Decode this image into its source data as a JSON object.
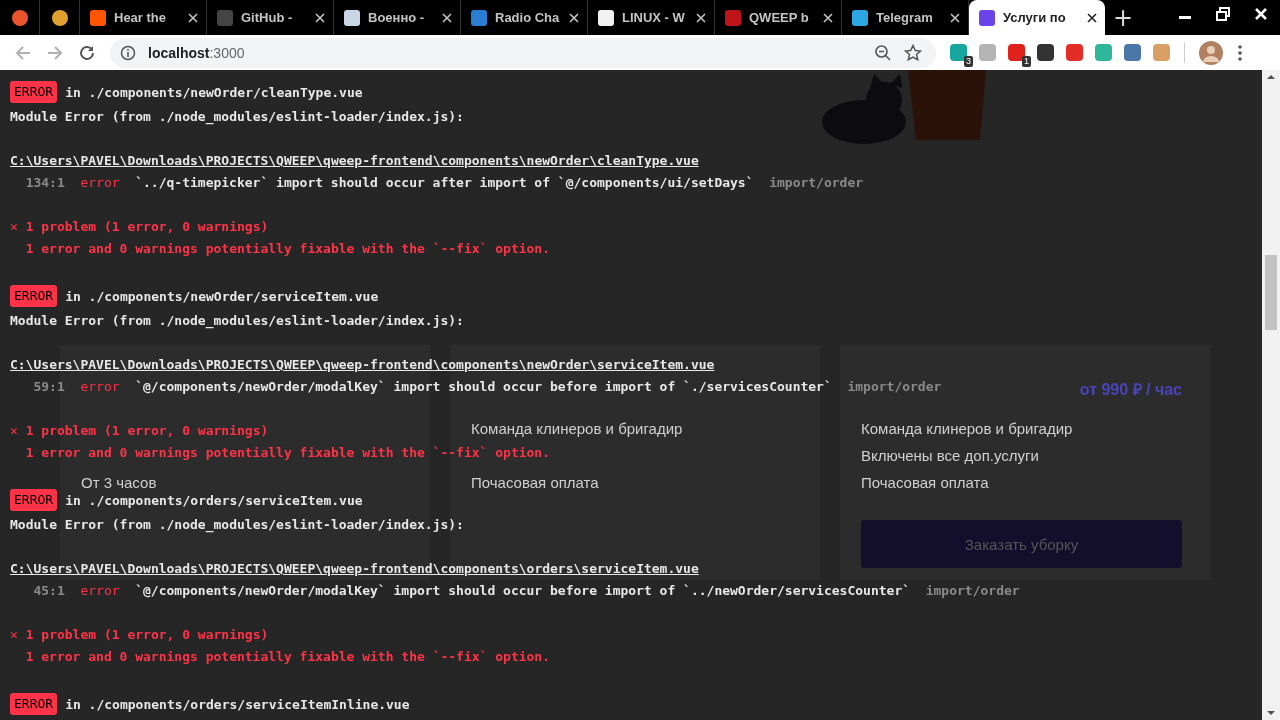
{
  "browser": {
    "tabs": [
      {
        "kind": "pinned",
        "color": "#e8542e",
        "selected": false
      },
      {
        "kind": "pinned",
        "color": "#e0a030",
        "selected": false
      },
      {
        "kind": "tab",
        "title": "Hear the",
        "color": "#ff5500",
        "selected": false
      },
      {
        "kind": "tab",
        "title": "GitHub -",
        "color": "#444444",
        "selected": false
      },
      {
        "kind": "tab",
        "title": "Военно -",
        "color": "#c9d6e6",
        "selected": false
      },
      {
        "kind": "tab",
        "title": "Radio Cha",
        "color": "#2b7cd3",
        "selected": false
      },
      {
        "kind": "tab",
        "title": "LINUX - W",
        "color": "#f2f2f2",
        "selected": false
      },
      {
        "kind": "tab",
        "title": "QWEEP b",
        "color": "#c0141b",
        "selected": false
      },
      {
        "kind": "tab",
        "title": "Telegram",
        "color": "#2ca5e0",
        "selected": false
      },
      {
        "kind": "tab",
        "title": "Услуги по",
        "color": "#6b45e8",
        "selected": true
      }
    ],
    "new_tab": "+",
    "address": {
      "host": "localhost",
      "port": ":3000"
    },
    "extensions": [
      {
        "color": "#17a5a0",
        "badge": "3"
      },
      {
        "color": "#b5b5b5"
      },
      {
        "color": "#e0201b",
        "badge": "1"
      },
      {
        "color": "#333333"
      },
      {
        "color": "#e52d27"
      },
      {
        "color": "#2fb59a"
      },
      {
        "color": "#4a76a8"
      },
      {
        "color": "#d9a066"
      }
    ]
  },
  "page": {
    "cards": [
      {
        "features": [
          "От 3 часов"
        ]
      },
      {
        "features": [
          "Команда клинеров и бригадир",
          "Почасовая оплата"
        ]
      },
      {
        "price": "от 990 ₽ / час",
        "features": [
          "Команда клинеров и бригадир",
          "Включены все доп.услуги",
          "Почасовая оплата"
        ],
        "button": "Заказать уборку"
      }
    ]
  },
  "errors": [
    {
      "badge": "ERROR",
      "file": "in ./components/newOrder/cleanType.vue",
      "source": "Module Error (from ./node_modules/eslint-loader/index.js):",
      "path": "C:\\Users\\PAVEL\\Downloads\\PROJECTS\\QWEEP\\qweep-frontend\\components\\newOrder\\cleanType.vue",
      "location": "134:1",
      "severity": "error",
      "message": "`../q-timepicker` import should occur after import of `@/components/ui/setDays`",
      "rule": "import/order",
      "summary": "✕ 1 problem (1 error, 0 warnings)",
      "hint": "1 error and 0 warnings potentially fixable with the `--fix` option."
    },
    {
      "badge": "ERROR",
      "file": "in ./components/newOrder/serviceItem.vue",
      "source": "Module Error (from ./node_modules/eslint-loader/index.js):",
      "path": "C:\\Users\\PAVEL\\Downloads\\PROJECTS\\QWEEP\\qweep-frontend\\components\\newOrder\\serviceItem.vue",
      "location": "59:1",
      "severity": "error",
      "message": "`@/components/newOrder/modalKey` import should occur before import of `./servicesCounter`",
      "rule": "import/order",
      "summary": "✕ 1 problem (1 error, 0 warnings)",
      "hint": "1 error and 0 warnings potentially fixable with the `--fix` option."
    },
    {
      "badge": "ERROR",
      "file": "in ./components/orders/serviceItem.vue",
      "source": "Module Error (from ./node_modules/eslint-loader/index.js):",
      "path": "C:\\Users\\PAVEL\\Downloads\\PROJECTS\\QWEEP\\qweep-frontend\\components\\orders\\serviceItem.vue",
      "location": "45:1",
      "severity": "error",
      "message": "`@/components/newOrder/modalKey` import should occur before import of `../newOrder/servicesCounter`",
      "rule": "import/order",
      "summary": "✕ 1 problem (1 error, 0 warnings)",
      "hint": "1 error and 0 warnings potentially fixable with the `--fix` option."
    },
    {
      "badge": "ERROR",
      "file": "in ./components/orders/serviceItemInline.vue"
    }
  ]
}
